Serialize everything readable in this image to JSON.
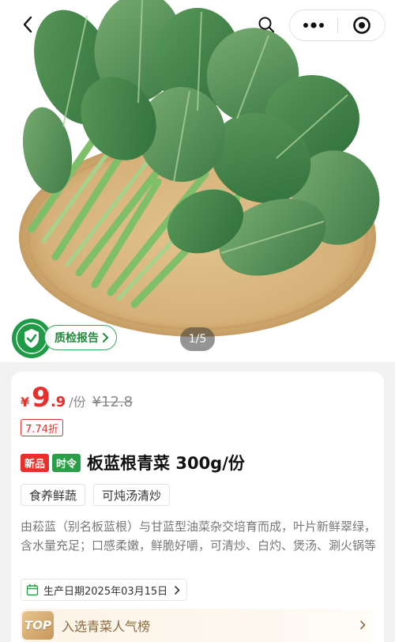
{
  "gallery": {
    "pager": "1/5",
    "quality_report": "质检报告"
  },
  "price": {
    "currency": "¥",
    "integer": "9",
    "decimal": ".9",
    "unit": "/份",
    "original": "¥12.8",
    "discount": "7.74折"
  },
  "product": {
    "badge_new": "新品",
    "badge_season": "时令",
    "title": "板蓝根青菜 300g/份",
    "tags": [
      "食养鲜蔬",
      "可炖汤清炒"
    ],
    "description": "由菘蓝（别名板蓝根）与甘蓝型油菜杂交培育而成，叶片新鲜翠绿，含水量充足；口感柔嫩，鲜脆好嚼，可清炒、白灼、煲汤、涮火锅等",
    "production_date": "生产日期2025年03月15日"
  },
  "ranking": {
    "badge": "TOP",
    "text": "入选青菜人气榜"
  },
  "colors": {
    "accent_red": "#e8302a",
    "accent_green": "#29a047",
    "gold": "#c6955a"
  },
  "icons": [
    "back-arrow-icon",
    "search-icon",
    "more-dots-icon",
    "close-target-icon",
    "quality-seal-icon",
    "chevron-right-icon",
    "calendar-icon"
  ]
}
